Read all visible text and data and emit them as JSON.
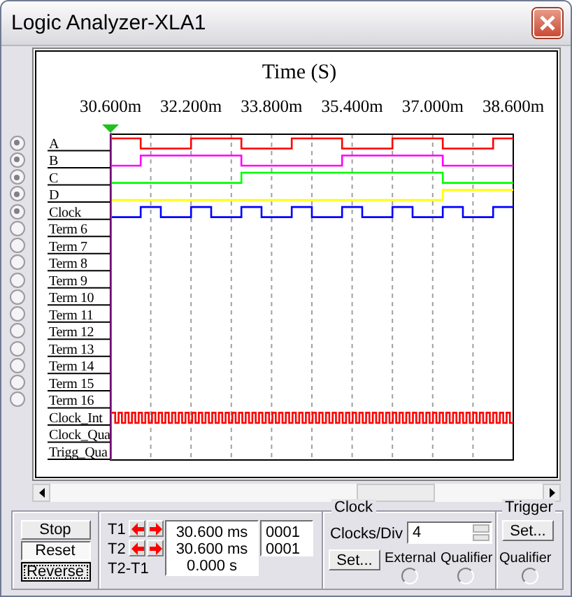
{
  "window": {
    "title": "Logic Analyzer-XLA1"
  },
  "terminals": [
    {
      "connected": true
    },
    {
      "connected": true
    },
    {
      "connected": true
    },
    {
      "connected": true
    },
    {
      "connected": true
    },
    {
      "connected": false
    },
    {
      "connected": false
    },
    {
      "connected": false
    },
    {
      "connected": false
    },
    {
      "connected": false
    },
    {
      "connected": false
    },
    {
      "connected": false
    },
    {
      "connected": false
    },
    {
      "connected": false
    },
    {
      "connected": false
    },
    {
      "connected": false
    }
  ],
  "timing_diagram": {
    "title": "Time (S)",
    "ticks": [
      "30.600m",
      "32.200m",
      "33.800m",
      "35.400m",
      "37.000m",
      "38.600m"
    ],
    "rows": [
      {
        "label": "A",
        "color": "#ff0000"
      },
      {
        "label": "B",
        "color": "#ff00ff"
      },
      {
        "label": "C",
        "color": "#00ff00"
      },
      {
        "label": "D",
        "color": "#ffff00"
      },
      {
        "label": "Clock",
        "color": "#0000ff"
      },
      {
        "label": "Term 6"
      },
      {
        "label": "Term 7"
      },
      {
        "label": "Term 8"
      },
      {
        "label": "Term 9"
      },
      {
        "label": "Term 10"
      },
      {
        "label": "Term 11"
      },
      {
        "label": "Term 12"
      },
      {
        "label": "Term 13"
      },
      {
        "label": "Term 14"
      },
      {
        "label": "Term 15"
      },
      {
        "label": "Term 16"
      },
      {
        "label": "Clock_Int",
        "color": "#ff0000"
      },
      {
        "label": "Clock_Qua"
      },
      {
        "label": "Trigg_Qua"
      }
    ]
  },
  "controls": [
    {
      "label": "Stop",
      "pressed": false,
      "focused": false
    },
    {
      "label": "Reset",
      "pressed": true,
      "focused": false
    },
    {
      "label": "Reverse",
      "pressed": false,
      "focused": true
    }
  ],
  "cursors": [
    {
      "label": "T1",
      "time": "30.600 ms",
      "value": "0001"
    },
    {
      "label": "T2",
      "time": "30.600 ms",
      "value": "0001"
    }
  ],
  "delta": {
    "label": "T2-T1",
    "time": "0.000 s"
  },
  "clock": {
    "title": "Clock",
    "clocks_per_div_label": "Clocks/Div",
    "clocks_per_div": "4",
    "set_button": "Set...",
    "options": [
      {
        "label": "External",
        "selected": false
      },
      {
        "label": "Qualifier",
        "selected": false
      }
    ]
  },
  "trigger": {
    "title": "Trigger",
    "set_button": "Set...",
    "qualifier": {
      "label": "Qualifier",
      "selected": false
    }
  }
}
